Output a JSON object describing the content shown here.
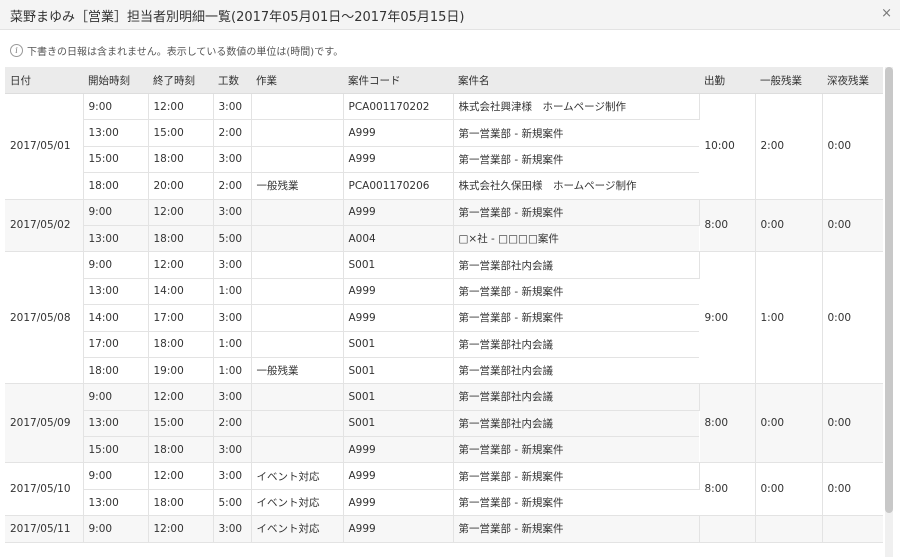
{
  "window": {
    "title": "菜野まゆみ［営業］担当者別明細一覧(2017年05月01日～2017年05月15日)",
    "close_label": "×"
  },
  "notice": "下書きの日報は含まれません。表示している数値の単位は(時間)です。",
  "columns": [
    "日付",
    "開始時刻",
    "終了時刻",
    "工数",
    "作業",
    "案件コード",
    "案件名",
    "出勤",
    "一般残業",
    "深夜残業"
  ],
  "groups": [
    {
      "date": "2017/05/01",
      "shukkin": "10:00",
      "ippan": "2:00",
      "shinya": "0:00",
      "rows": [
        {
          "start": "9:00",
          "end": "12:00",
          "kosu": "3:00",
          "sagyo": "",
          "code": "PCA001170202",
          "name": "株式会社興津様　ホームページ制作"
        },
        {
          "start": "13:00",
          "end": "15:00",
          "kosu": "2:00",
          "sagyo": "",
          "code": "A999",
          "name": "第一営業部 - 新規案件"
        },
        {
          "start": "15:00",
          "end": "18:00",
          "kosu": "3:00",
          "sagyo": "",
          "code": "A999",
          "name": "第一営業部 - 新規案件"
        },
        {
          "start": "18:00",
          "end": "20:00",
          "kosu": "2:00",
          "sagyo": "一般残業",
          "code": "PCA001170206",
          "name": "株式会社久保田様　ホームページ制作"
        }
      ]
    },
    {
      "date": "2017/05/02",
      "shukkin": "8:00",
      "ippan": "0:00",
      "shinya": "0:00",
      "rows": [
        {
          "start": "9:00",
          "end": "12:00",
          "kosu": "3:00",
          "sagyo": "",
          "code": "A999",
          "name": "第一営業部 - 新規案件"
        },
        {
          "start": "13:00",
          "end": "18:00",
          "kosu": "5:00",
          "sagyo": "",
          "code": "A004",
          "name": "□×社 - □□□□案件"
        }
      ]
    },
    {
      "date": "2017/05/08",
      "shukkin": "9:00",
      "ippan": "1:00",
      "shinya": "0:00",
      "rows": [
        {
          "start": "9:00",
          "end": "12:00",
          "kosu": "3:00",
          "sagyo": "",
          "code": "S001",
          "name": "第一営業部社内会議"
        },
        {
          "start": "13:00",
          "end": "14:00",
          "kosu": "1:00",
          "sagyo": "",
          "code": "A999",
          "name": "第一営業部 - 新規案件"
        },
        {
          "start": "14:00",
          "end": "17:00",
          "kosu": "3:00",
          "sagyo": "",
          "code": "A999",
          "name": "第一営業部 - 新規案件"
        },
        {
          "start": "17:00",
          "end": "18:00",
          "kosu": "1:00",
          "sagyo": "",
          "code": "S001",
          "name": "第一営業部社内会議"
        },
        {
          "start": "18:00",
          "end": "19:00",
          "kosu": "1:00",
          "sagyo": "一般残業",
          "code": "S001",
          "name": "第一営業部社内会議"
        }
      ]
    },
    {
      "date": "2017/05/09",
      "shukkin": "8:00",
      "ippan": "0:00",
      "shinya": "0:00",
      "rows": [
        {
          "start": "9:00",
          "end": "12:00",
          "kosu": "3:00",
          "sagyo": "",
          "code": "S001",
          "name": "第一営業部社内会議"
        },
        {
          "start": "13:00",
          "end": "15:00",
          "kosu": "2:00",
          "sagyo": "",
          "code": "S001",
          "name": "第一営業部社内会議"
        },
        {
          "start": "15:00",
          "end": "18:00",
          "kosu": "3:00",
          "sagyo": "",
          "code": "A999",
          "name": "第一営業部 - 新規案件"
        }
      ]
    },
    {
      "date": "2017/05/10",
      "shukkin": "8:00",
      "ippan": "0:00",
      "shinya": "0:00",
      "rows": [
        {
          "start": "9:00",
          "end": "12:00",
          "kosu": "3:00",
          "sagyo": "イベント対応",
          "code": "A999",
          "name": "第一営業部 - 新規案件"
        },
        {
          "start": "13:00",
          "end": "18:00",
          "kosu": "5:00",
          "sagyo": "イベント対応",
          "code": "A999",
          "name": "第一営業部 - 新規案件"
        }
      ]
    },
    {
      "date": "2017/05/11",
      "shukkin": "",
      "ippan": "",
      "shinya": "",
      "rows": [
        {
          "start": "9:00",
          "end": "12:00",
          "kosu": "3:00",
          "sagyo": "イベント対応",
          "code": "A999",
          "name": "第一営業部 - 新規案件"
        }
      ]
    }
  ],
  "icons": {
    "info": "info-icon",
    "close": "close-icon"
  }
}
